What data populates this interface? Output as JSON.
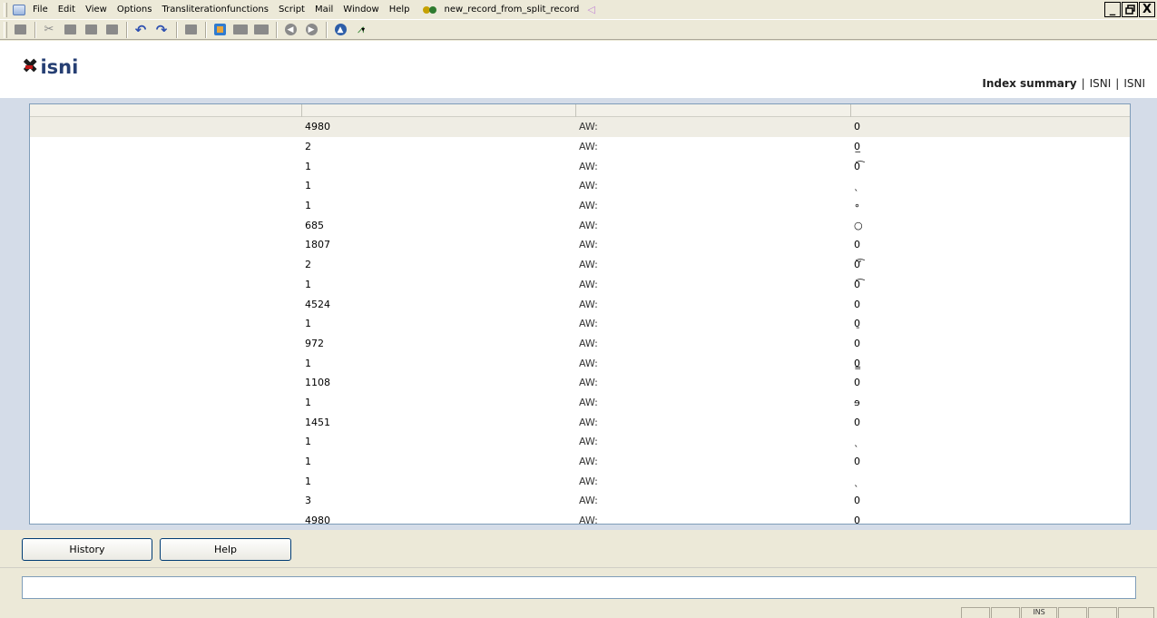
{
  "menubar": {
    "items": [
      "File",
      "Edit",
      "View",
      "Options",
      "Transliterationfunctions",
      "Script",
      "Mail",
      "Window",
      "Help"
    ],
    "document_title": "new_record_from_split_record",
    "window_buttons": [
      "_",
      " ",
      "X"
    ]
  },
  "header": {
    "logo_text": "isni",
    "links": [
      "Index summary",
      "ISNI",
      "ISNI"
    ],
    "separator": "|"
  },
  "grid": {
    "rows": [
      {
        "count": "4980",
        "index": "AW:",
        "value": "0",
        "selected": true
      },
      {
        "count": "2",
        "index": "AW:",
        "value": "0̲"
      },
      {
        "count": "1",
        "index": "AW:",
        "value": "0͡"
      },
      {
        "count": "1",
        "index": "AW:",
        "value": "ˎ"
      },
      {
        "count": "1",
        "index": "AW:",
        "value": "∘"
      },
      {
        "count": "685",
        "index": "AW:",
        "value": "○"
      },
      {
        "count": "1807",
        "index": "AW:",
        "value": "0"
      },
      {
        "count": "2",
        "index": "AW:",
        "value": "0̕͡"
      },
      {
        "count": "1",
        "index": "AW:",
        "value": "0͡"
      },
      {
        "count": "4524",
        "index": "AW:",
        "value": "0"
      },
      {
        "count": "1",
        "index": "AW:",
        "value": "0̱"
      },
      {
        "count": "972",
        "index": "AW:",
        "value": "0"
      },
      {
        "count": "1",
        "index": "AW:",
        "value": "0̳"
      },
      {
        "count": "1108",
        "index": "AW:",
        "value": "0"
      },
      {
        "count": "1",
        "index": "AW:",
        "value": "ɘ"
      },
      {
        "count": "1451",
        "index": "AW:",
        "value": "0"
      },
      {
        "count": "1",
        "index": "AW:",
        "value": "ˎ"
      },
      {
        "count": "1",
        "index": "AW:",
        "value": "0"
      },
      {
        "count": "1",
        "index": "AW:",
        "value": "ˎ"
      },
      {
        "count": "3",
        "index": "AW:",
        "value": "0"
      },
      {
        "count": "4980",
        "index": "AW:",
        "value": "0"
      }
    ]
  },
  "buttons": {
    "history": "History",
    "help": "Help"
  },
  "message": {
    "value": ""
  },
  "statusbar": {
    "mode": "INS"
  },
  "colors": {
    "brand_dark": "#263f73",
    "logo_accent": "#c01818",
    "grid_background": "#d4dce8",
    "selected_row": "#efede4"
  },
  "icons": [
    "print-icon",
    "cut-icon",
    "copy-icon",
    "paste-icon",
    "save-icon",
    "undo-icon",
    "redo-icon",
    "disk-icon",
    "home-icon",
    "prev-icon",
    "next-icon",
    "back-icon",
    "forward-icon",
    "upload-icon",
    "tool-icon"
  ]
}
